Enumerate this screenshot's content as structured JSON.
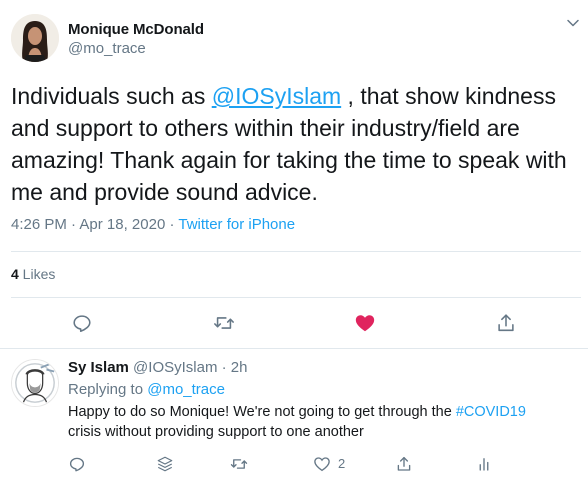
{
  "main_tweet": {
    "author_name": "Monique McDonald",
    "author_handle": "@mo_trace",
    "text_before": "Individuals such as ",
    "mention": "@IOSyIslam",
    "text_after": " , that show kindness and support to others within their industry/field are amazing! Thank again for taking the time to speak with me and provide sound advice.",
    "time": "4:26 PM",
    "date": "Apr 18, 2020",
    "separator": " · ",
    "source": "Twitter for iPhone",
    "likes_count": "4",
    "likes_label": " Likes",
    "actions": [
      "reply-icon",
      "retweet-icon",
      "like-icon-filled",
      "share-icon"
    ]
  },
  "reply_tweet": {
    "author_name": "Sy Islam",
    "author_handle": "@IOSyIslam",
    "time_ago": "2h",
    "replying_prefix": "Replying to ",
    "replying_to": "@mo_trace",
    "text_line1": "Happy to do so Monique! We're not going to get through the ",
    "hashtag": "#COVID19",
    "text_line2": " crisis without providing support to one another",
    "like_count": "2",
    "actions": [
      "reply-icon",
      "stack-icon",
      "retweet-icon",
      "like-icon",
      "share-icon",
      "analytics-icon"
    ]
  },
  "colors": {
    "accent": "#1da1f2",
    "muted": "#657786",
    "like_red": "#e0245e",
    "border": "#e1e8ed"
  }
}
